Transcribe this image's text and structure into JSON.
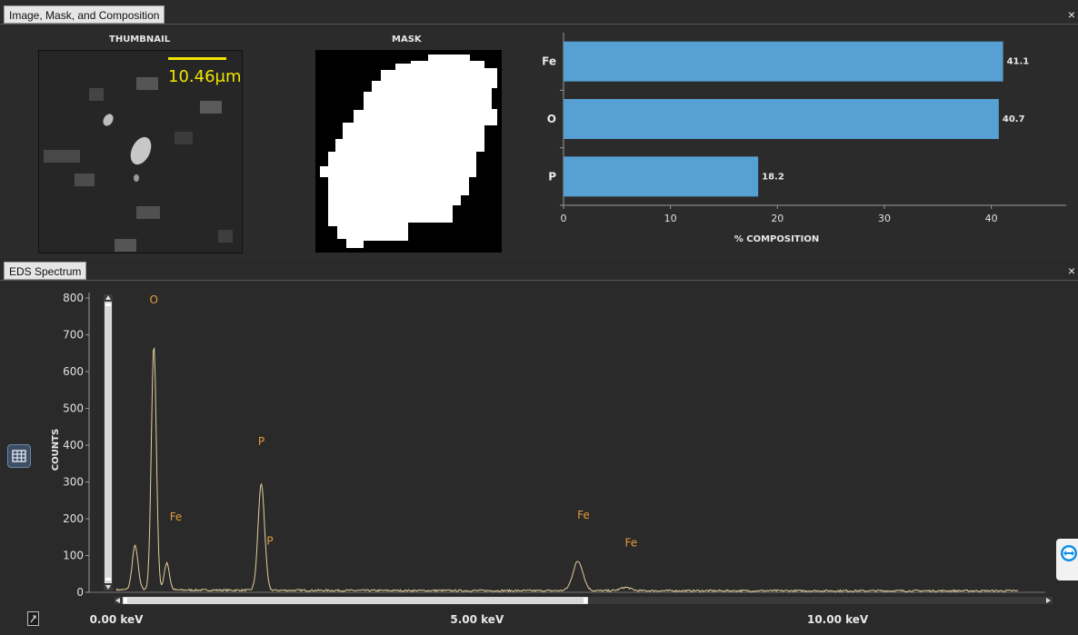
{
  "top_panel": {
    "tab_label": "Image, Mask, and Composition",
    "thumbnail_title": "THUMBNAIL",
    "mask_title": "MASK",
    "scale_bar_label": "10.46μm"
  },
  "bottom_panel": {
    "tab_label": "EDS Spectrum"
  },
  "close_glyph": "×",
  "chart_data": [
    {
      "type": "bar",
      "orientation": "horizontal",
      "categories": [
        "Fe",
        "O",
        "P"
      ],
      "values": [
        41.1,
        40.7,
        18.2
      ],
      "value_labels": [
        "41.1",
        "40.7",
        "18.2"
      ],
      "xlabel": "% COMPOSITION",
      "xlim": [
        0,
        47
      ],
      "xticks": [
        "0",
        "10",
        "20",
        "30",
        "40"
      ],
      "bar_color": "#56a0d3",
      "grid": false
    },
    {
      "type": "line",
      "ylabel": "COUNTS",
      "ylim": [
        0,
        820
      ],
      "yticks": [
        "0",
        "100",
        "200",
        "300",
        "400",
        "500",
        "600",
        "700",
        "800"
      ],
      "xlim": [
        0,
        12.5
      ],
      "xticks": [
        "0.00 keV",
        "5.00 keV",
        "10.00 keV"
      ],
      "line_color": "#e3cf9a",
      "peaks": [
        {
          "x": 0.26,
          "y": 120,
          "w": 0.04
        },
        {
          "x": 0.52,
          "y": 665,
          "w": 0.035
        },
        {
          "x": 0.7,
          "y": 75,
          "w": 0.035
        },
        {
          "x": 2.01,
          "y": 290,
          "w": 0.045
        },
        {
          "x": 6.4,
          "y": 80,
          "w": 0.07
        },
        {
          "x": 7.06,
          "y": 9,
          "w": 0.07
        }
      ],
      "annotations": [
        {
          "text": "O",
          "x": 0.52,
          "y": 785
        },
        {
          "text": "Fe",
          "x": 0.75,
          "y": 195
        },
        {
          "text": "P",
          "x": 2.01,
          "y": 400
        },
        {
          "text": "P",
          "x": 2.13,
          "y": 130
        },
        {
          "text": "Fe",
          "x": 6.4,
          "y": 200
        },
        {
          "text": "Fe",
          "x": 7.06,
          "y": 125
        }
      ],
      "annotation_color": "#e39a3a"
    }
  ]
}
